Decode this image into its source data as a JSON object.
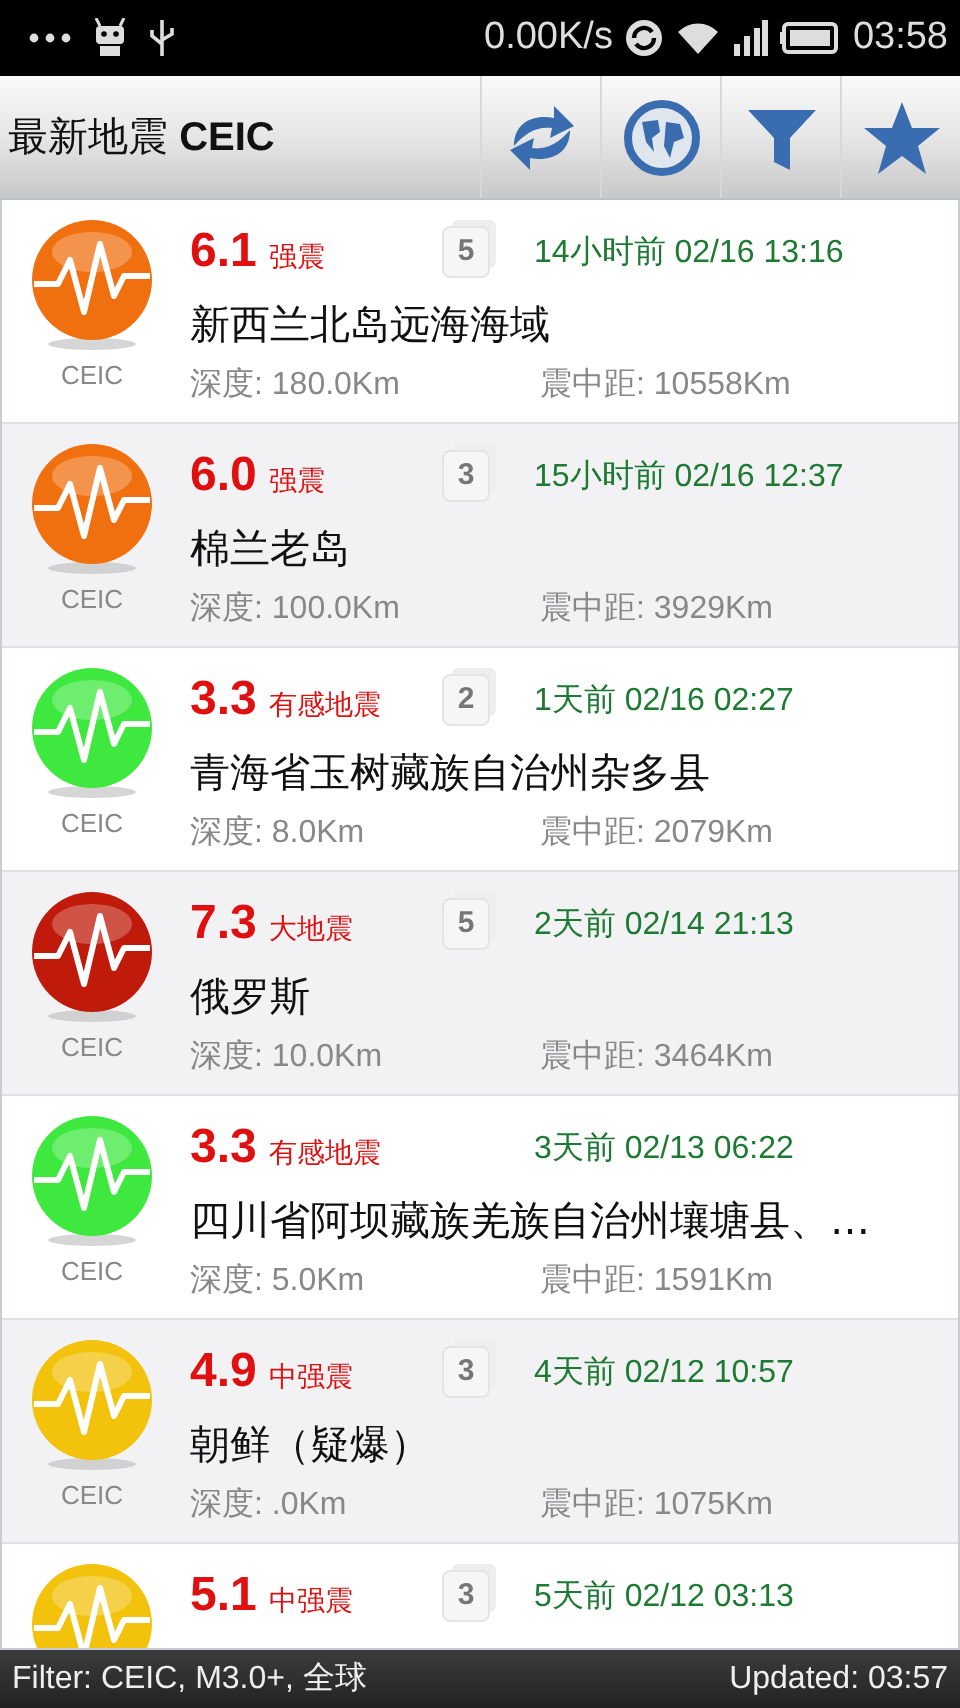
{
  "status_bar": {
    "net_speed": "0.00K/s",
    "time": "03:58"
  },
  "app_bar": {
    "title": "最新地震",
    "title_suffix": "CEIC"
  },
  "quakes": [
    {
      "magnitude": "6.1",
      "category": "强震",
      "badge": "5",
      "time": "14小时前 02/16 13:16",
      "place": "新西兰北岛远海海域",
      "depth": "深度: 180.0Km",
      "distance": "震中距: 10558Km",
      "source": "CEIC",
      "color": "#f07010"
    },
    {
      "magnitude": "6.0",
      "category": "强震",
      "badge": "3",
      "time": "15小时前 02/16 12:37",
      "place": "棉兰老岛",
      "depth": "深度: 100.0Km",
      "distance": "震中距: 3929Km",
      "source": "CEIC",
      "color": "#f07010"
    },
    {
      "magnitude": "3.3",
      "category": "有感地震",
      "badge": "2",
      "time": "1天前 02/16 02:27",
      "place": "青海省玉树藏族自治州杂多县",
      "depth": "深度: 8.0Km",
      "distance": "震中距: 2079Km",
      "source": "CEIC",
      "color": "#3ee83e"
    },
    {
      "magnitude": "7.3",
      "category": "大地震",
      "badge": "5",
      "time": "2天前 02/14 21:13",
      "place": "俄罗斯",
      "depth": "深度: 10.0Km",
      "distance": "震中距: 3464Km",
      "source": "CEIC",
      "color": "#c01a0a"
    },
    {
      "magnitude": "3.3",
      "category": "有感地震",
      "time": "3天前 02/13 06:22",
      "place": "四川省阿坝藏族羌族自治州壤塘县、…",
      "depth": "深度: 5.0Km",
      "distance": "震中距: 1591Km",
      "source": "CEIC",
      "color": "#3ee83e"
    },
    {
      "magnitude": "4.9",
      "category": "中强震",
      "badge": "3",
      "time": "4天前 02/12 10:57",
      "place": "朝鲜（疑爆）",
      "depth": "深度: .0Km",
      "distance": "震中距: 1075Km",
      "source": "CEIC",
      "color": "#f2c20c"
    },
    {
      "magnitude": "5.1",
      "category": "中强震",
      "badge": "3",
      "time": "5天前 02/12 03:13",
      "color": "#f2c20c"
    }
  ],
  "footer": {
    "filter": "Filter: CEIC, M3.0+, 全球",
    "updated": "Updated: 03:57"
  }
}
